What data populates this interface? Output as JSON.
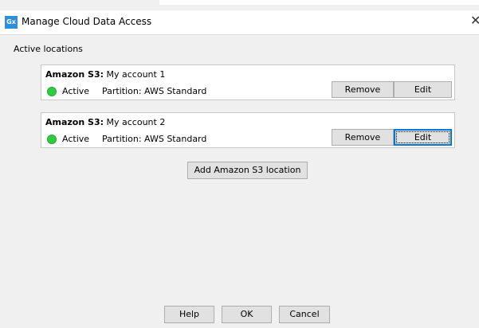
{
  "window": {
    "app_icon_text": "Gx",
    "title": "Manage Cloud Data Access",
    "close_glyph": "✕"
  },
  "section_label": "Active locations",
  "locations": [
    {
      "brand": "Amazon S3:",
      "name": "My account 1",
      "status": "Active",
      "status_color": "#2ecc40",
      "partition": "Partition: AWS Standard",
      "remove_label": "Remove",
      "edit_label": "Edit"
    },
    {
      "brand": "Amazon S3:",
      "name": "My account 2",
      "status": "Active",
      "status_color": "#2ecc40",
      "partition": "Partition: AWS Standard",
      "remove_label": "Remove",
      "edit_label": "Edit"
    }
  ],
  "add_location_label": "Add Amazon S3 location",
  "footer": {
    "help_label": "Help",
    "ok_label": "OK",
    "cancel_label": "Cancel"
  }
}
